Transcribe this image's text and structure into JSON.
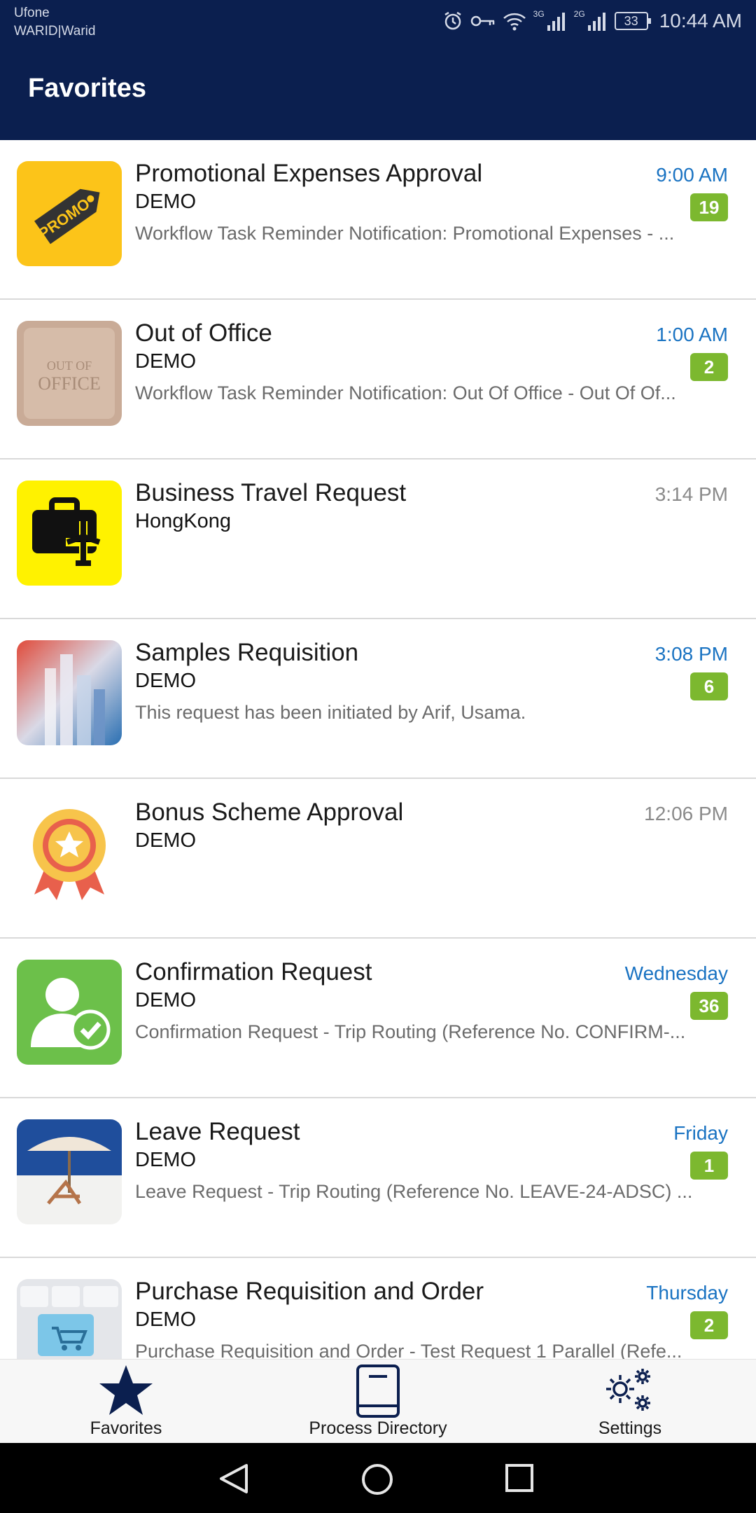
{
  "status_bar": {
    "carrier_1": "Ufone",
    "carrier_2": "WARID|Warid",
    "network_1": "3G",
    "network_2": "2G",
    "battery": "33",
    "time": "10:44 AM"
  },
  "header": {
    "title": "Favorites"
  },
  "colors": {
    "app_bar": "#0b1f4f",
    "accent_time": "#1a73c2",
    "badge": "#7cb82f",
    "nav_icon": "#0b1f4f"
  },
  "items": [
    {
      "title": "Promotional Expenses Approval",
      "subtitle": "DEMO",
      "description": "Workflow Task Reminder Notification: Promotional Expenses - ...",
      "time": "9:00 AM",
      "badge": "19",
      "icon": "promo-tag-icon"
    },
    {
      "title": "Out of Office",
      "subtitle": "DEMO",
      "description": "Workflow Task Reminder Notification: Out Of Office - Out Of Of...",
      "time": "1:00 AM",
      "badge": "2",
      "icon": "out-of-office-icon"
    },
    {
      "title": "Business Travel Request",
      "subtitle": "HongKong",
      "description": "",
      "time": "3:14 PM",
      "badge": "",
      "icon": "travel-briefcase-icon"
    },
    {
      "title": "Samples Requisition",
      "subtitle": "DEMO",
      "description": "This request has been initiated by Arif, Usama.",
      "time": "3:08 PM",
      "badge": "6",
      "icon": "city-image-icon"
    },
    {
      "title": "Bonus Scheme Approval",
      "subtitle": "DEMO",
      "description": "",
      "time": "12:06 PM",
      "badge": "",
      "icon": "award-medal-icon"
    },
    {
      "title": "Confirmation Request",
      "subtitle": "DEMO",
      "description": "Confirmation Request - Trip Routing (Reference No. CONFIRM-...",
      "time": "Wednesday",
      "badge": "36",
      "icon": "user-check-icon"
    },
    {
      "title": "Leave Request",
      "subtitle": "DEMO",
      "description": "Leave Request - Trip Routing (Reference No. LEAVE-24-ADSC) ...",
      "time": "Friday",
      "badge": "1",
      "icon": "beach-chair-icon"
    },
    {
      "title": "Purchase Requisition and Order",
      "subtitle": "DEMO",
      "description": "Purchase Requisition and Order - Test Request 1 Parallel (Refe...",
      "time": "Thursday",
      "badge": "2",
      "icon": "shopping-cart-key-icon"
    }
  ],
  "bottom_nav": {
    "favorites": "Favorites",
    "process_directory": "Process Directory",
    "settings": "Settings"
  }
}
